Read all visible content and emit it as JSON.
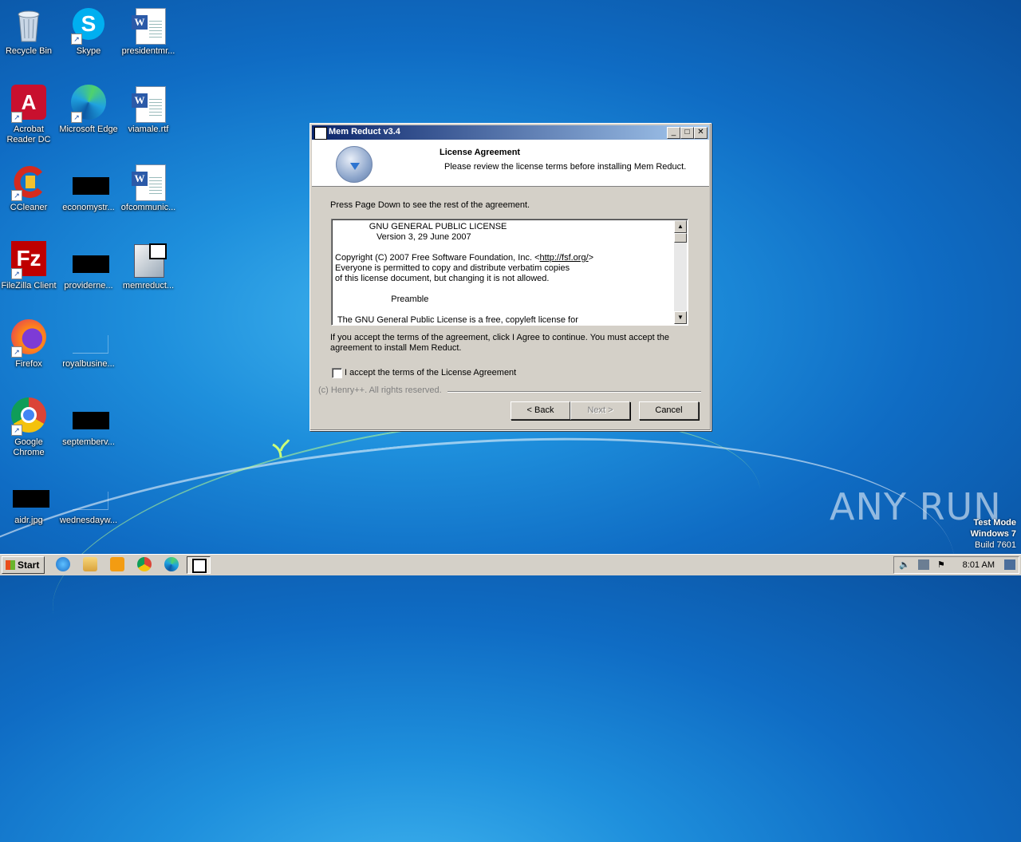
{
  "desktop": {
    "icons": [
      {
        "label": "Recycle Bin"
      },
      {
        "label": "Skype"
      },
      {
        "label": "presidentmr..."
      },
      {
        "label": "Acrobat Reader DC"
      },
      {
        "label": "Microsoft Edge"
      },
      {
        "label": "viamale.rtf"
      },
      {
        "label": "CCleaner"
      },
      {
        "label": "economystr..."
      },
      {
        "label": "ofcommunic..."
      },
      {
        "label": "FileZilla Client"
      },
      {
        "label": "providerne..."
      },
      {
        "label": "memreduct..."
      },
      {
        "label": "Firefox"
      },
      {
        "label": "royalbusine..."
      },
      {
        "label": "Google Chrome"
      },
      {
        "label": "septemberv..."
      },
      {
        "label": "aidr.jpg"
      },
      {
        "label": "wednesdayw..."
      }
    ]
  },
  "dialog": {
    "title": "Mem Reduct v3.4",
    "header_title": "License Agreement",
    "header_subtitle": "Please review the license terms before installing Mem Reduct.",
    "instruction": "Press Page Down to see the rest of the agreement.",
    "license_lines": [
      "              GNU GENERAL PUBLIC LICENSE",
      "                 Version 3, 29 June 2007",
      "",
      "Copyright (C) 2007 Free Software Foundation, Inc. <",
      "http://fsf.org/",
      ">",
      "Everyone is permitted to copy and distribute verbatim copies",
      "of this license document, but changing it is not allowed.",
      "",
      "                       Preamble",
      "",
      " The GNU General Public License is a free, copyleft license for"
    ],
    "accept_info": "If you accept the terms of the agreement, click I Agree to continue. You must accept the agreement to install Mem Reduct.",
    "checkbox_label": "I accept the terms of the License Agreement",
    "checkbox_checked": false,
    "branding": "(c) Henry++. All rights reserved.",
    "buttons": {
      "back": "< Back",
      "next": "Next >",
      "cancel": "Cancel"
    }
  },
  "taskbar": {
    "start_label": "Start",
    "clock": "8:01 AM"
  },
  "watermark": {
    "text": "ANY RUN"
  },
  "test_mode": {
    "line1": "Test Mode",
    "line2": "Windows 7",
    "line3": "Build 7601"
  }
}
